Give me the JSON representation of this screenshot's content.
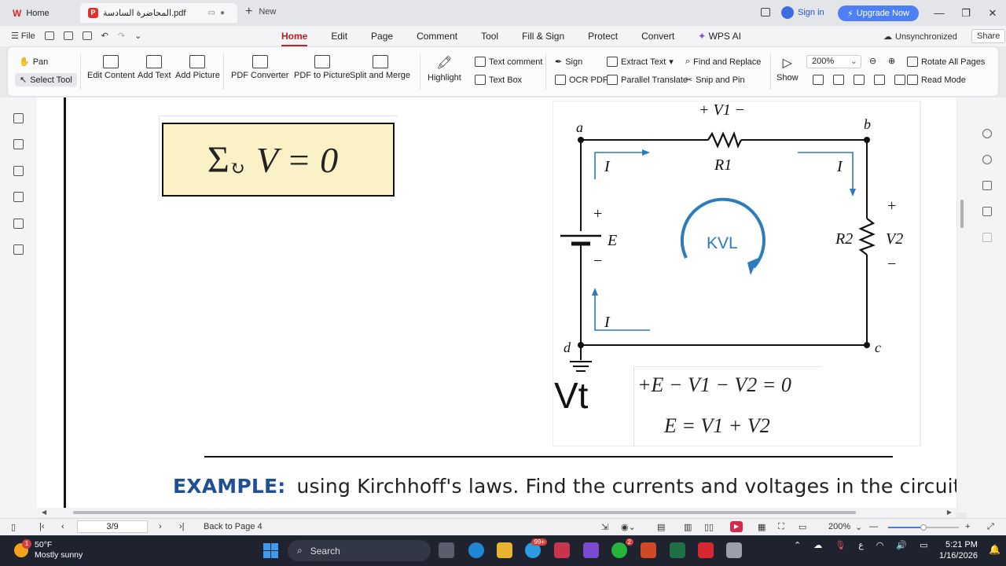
{
  "titlebar": {
    "home_tab": "Home",
    "doc_tab": "المحاضرة السادسة.pdf",
    "new_tab": "New",
    "sign_in": "Sign in",
    "upgrade": "Upgrade Now"
  },
  "menubar": {
    "file": "File",
    "tabs": [
      "Home",
      "Edit",
      "Page",
      "Comment",
      "Tool",
      "Fill & Sign",
      "Protect",
      "Convert",
      "WPS AI"
    ],
    "active_tab": "Home",
    "sync_status": "Unsynchronized",
    "share": "Share"
  },
  "ribbon": {
    "pan": "Pan",
    "select_tool": "Select Tool",
    "edit_content": "Edit Content",
    "add_text": "Add Text",
    "add_picture": "Add Picture",
    "pdf_converter": "PDF Converter",
    "pdf_to_picture": "PDF to Picture",
    "split_merge": "Split and Merge",
    "highlight": "Highlight",
    "text_comment": "Text comment",
    "text_box": "Text Box",
    "sign": "Sign",
    "ocr_pdf": "OCR PDF",
    "extract_text": "Extract Text",
    "parallel_translate": "Parallel Translate",
    "find_replace": "Find and Replace",
    "snip_pin": "Snip and Pin",
    "show": "Show",
    "zoom": "200%",
    "rotate_all": "Rotate All Pages",
    "read_mode": "Read Mode"
  },
  "document": {
    "kvl_formula": {
      "sigma": "Σ",
      "rhs": "V = 0"
    },
    "circuit": {
      "nodes": [
        "a",
        "b",
        "c",
        "d"
      ],
      "v1_label": "+ V1 −",
      "r1": "R1",
      "r2": "R2",
      "v2": "V2",
      "source": "E",
      "current": "I",
      "loop": "KVL",
      "plus": "+",
      "minus": "−"
    },
    "equation_1": "+E − V1 − V2 = 0",
    "equation_2": "E = V1 + V2",
    "vt": "Vt",
    "example_label": "EXAMPLE:",
    "example_text": "using Kirchhoff's laws. Find the currents and voltages in the circuit"
  },
  "statusbar": {
    "page": "3/9",
    "back_to": "Back to Page 4",
    "zoom": "200%",
    "zoom_fraction": 0.5
  },
  "taskbar": {
    "temperature": "50°F",
    "weather": "Mostly sunny",
    "weather_badge": "1",
    "search": "Search",
    "teams_badge": "99+",
    "whatsapp_badge": "2",
    "time": "5:21 PM",
    "date": "1/16/2026",
    "lang": "ع"
  },
  "colors": {
    "accent_red": "#b81d22",
    "upgrade_blue": "#4c80f4",
    "formula_fill": "#fbf1c6",
    "circuit_blue": "#2b7bbd",
    "example_blue": "#1f4f99"
  }
}
